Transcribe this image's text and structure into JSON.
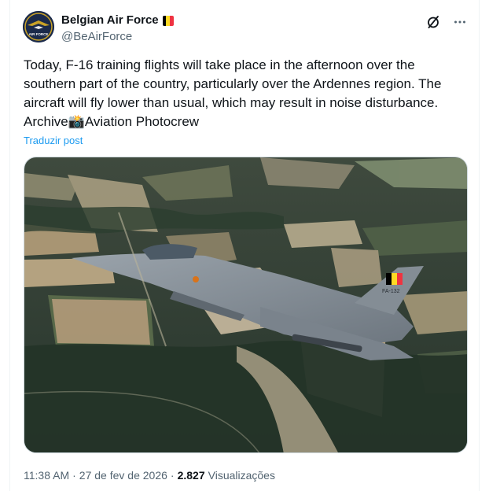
{
  "author": {
    "display_name": "Belgian Air Force",
    "handle": "@BeAirForce",
    "flag_colors": [
      "#000000",
      "#FDDA24",
      "#EF3340"
    ],
    "avatar_icon": "belgian-air-force-badge-icon",
    "avatar_text": "AIR FORCE"
  },
  "actions": {
    "grok_icon": "slashed-circle-icon",
    "more_icon": "more-dots-icon",
    "more_label": "···"
  },
  "tweet": {
    "text": "Today, F-16 training flights will take place in the afternoon over the\nsouthern part of the country, particularly over the Ardennes region. The\naircraft will fly lower than usual, which may result in noise disturbance.\nArchive📸Aviation Photocrew",
    "translate_label": "Traduzir post"
  },
  "media": {
    "image_icon": "f16-aerial-photo",
    "tail_code": "FA-132"
  },
  "meta": {
    "time": "11:38 AM",
    "separator_1": "·",
    "date": "27 de fev de 2026",
    "separator_2": "·",
    "views_count": "2.827",
    "views_label": "Visualizações"
  },
  "colors": {
    "link": "#1d9bf0",
    "secondary_text": "#536471",
    "primary_text": "#0f1419",
    "border": "#cfd9de"
  }
}
